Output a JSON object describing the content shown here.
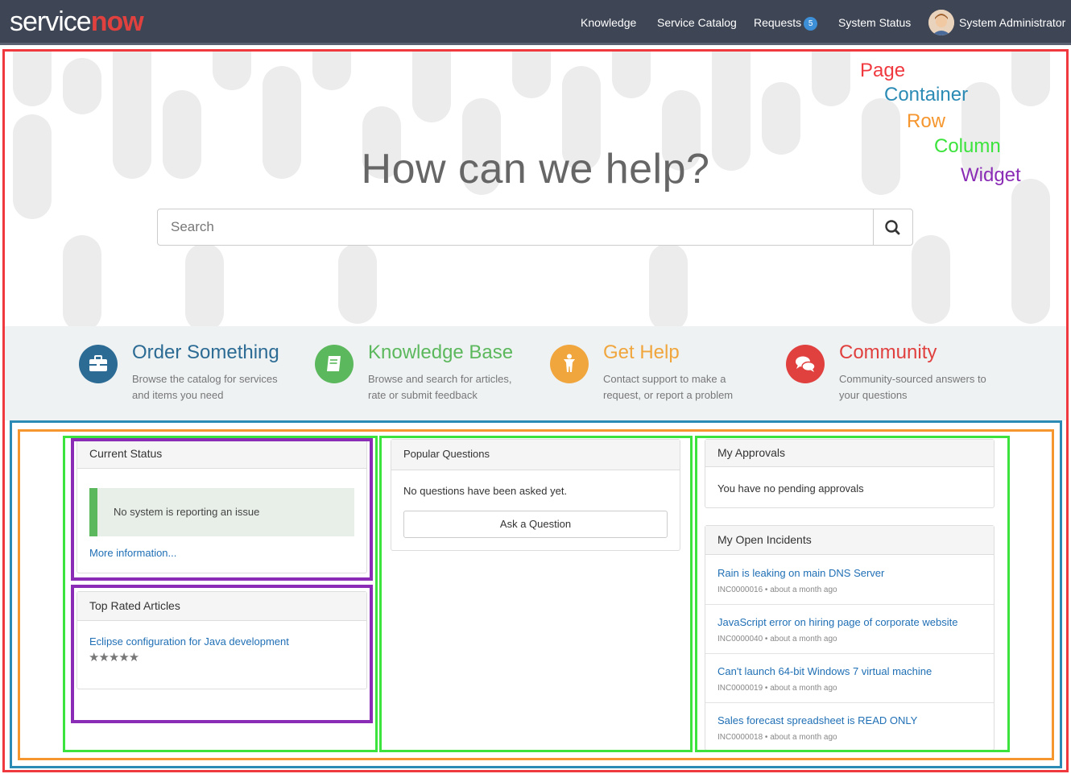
{
  "header": {
    "logo_service": "service",
    "logo_now": "now",
    "nav": [
      {
        "label": "Knowledge"
      },
      {
        "label": "Service Catalog"
      },
      {
        "label": "Requests",
        "badge": "5"
      },
      {
        "label": "System Status"
      }
    ],
    "user": "System Administrator"
  },
  "hero": {
    "title": "How can we help?",
    "search_placeholder": "Search"
  },
  "legend": {
    "page": "Page",
    "container": "Container",
    "row": "Row",
    "column": "Column",
    "widget": "Widget"
  },
  "quick_links": [
    {
      "title": "Order Something",
      "desc": "Browse the catalog for services and items you need",
      "color": "#2c6b94",
      "icon": "briefcase-icon"
    },
    {
      "title": "Knowledge Base",
      "desc": "Browse and search for articles, rate or submit feedback",
      "color": "#5cb85c",
      "icon": "book-icon"
    },
    {
      "title": "Get Help",
      "desc": "Contact support to make a request, or report a problem",
      "color": "#f0a63d",
      "icon": "person-icon"
    },
    {
      "title": "Community",
      "desc": "Community-sourced answers to your questions",
      "color": "#e0413f",
      "icon": "chat-bubbles-icon"
    }
  ],
  "current_status": {
    "title": "Current Status",
    "message": "No system is reporting an issue",
    "more": "More information..."
  },
  "top_rated": {
    "title": "Top Rated Articles",
    "article": "Eclipse configuration for Java development",
    "stars": "★★★★★"
  },
  "popular_questions": {
    "title": "Popular Questions",
    "empty": "No questions have been asked yet.",
    "button": "Ask a Question"
  },
  "approvals": {
    "title": "My Approvals",
    "empty": "You have no pending approvals"
  },
  "incidents": {
    "title": "My Open Incidents",
    "items": [
      {
        "title": "Rain is leaking on main DNS Server",
        "meta": "INC0000016 • about a month ago"
      },
      {
        "title": "JavaScript error on hiring page of corporate website",
        "meta": "INC0000040 • about a month ago"
      },
      {
        "title": "Can't launch 64-bit Windows 7 virtual machine",
        "meta": "INC0000019 • about a month ago"
      },
      {
        "title": "Sales forecast spreadsheet is READ ONLY",
        "meta": "INC0000018 • about a month ago"
      }
    ]
  },
  "colors": {
    "page": "#f0393f",
    "container": "#2b8bb5",
    "row": "#f5962e",
    "column": "#3ce33c",
    "widget": "#8a2cb5"
  }
}
